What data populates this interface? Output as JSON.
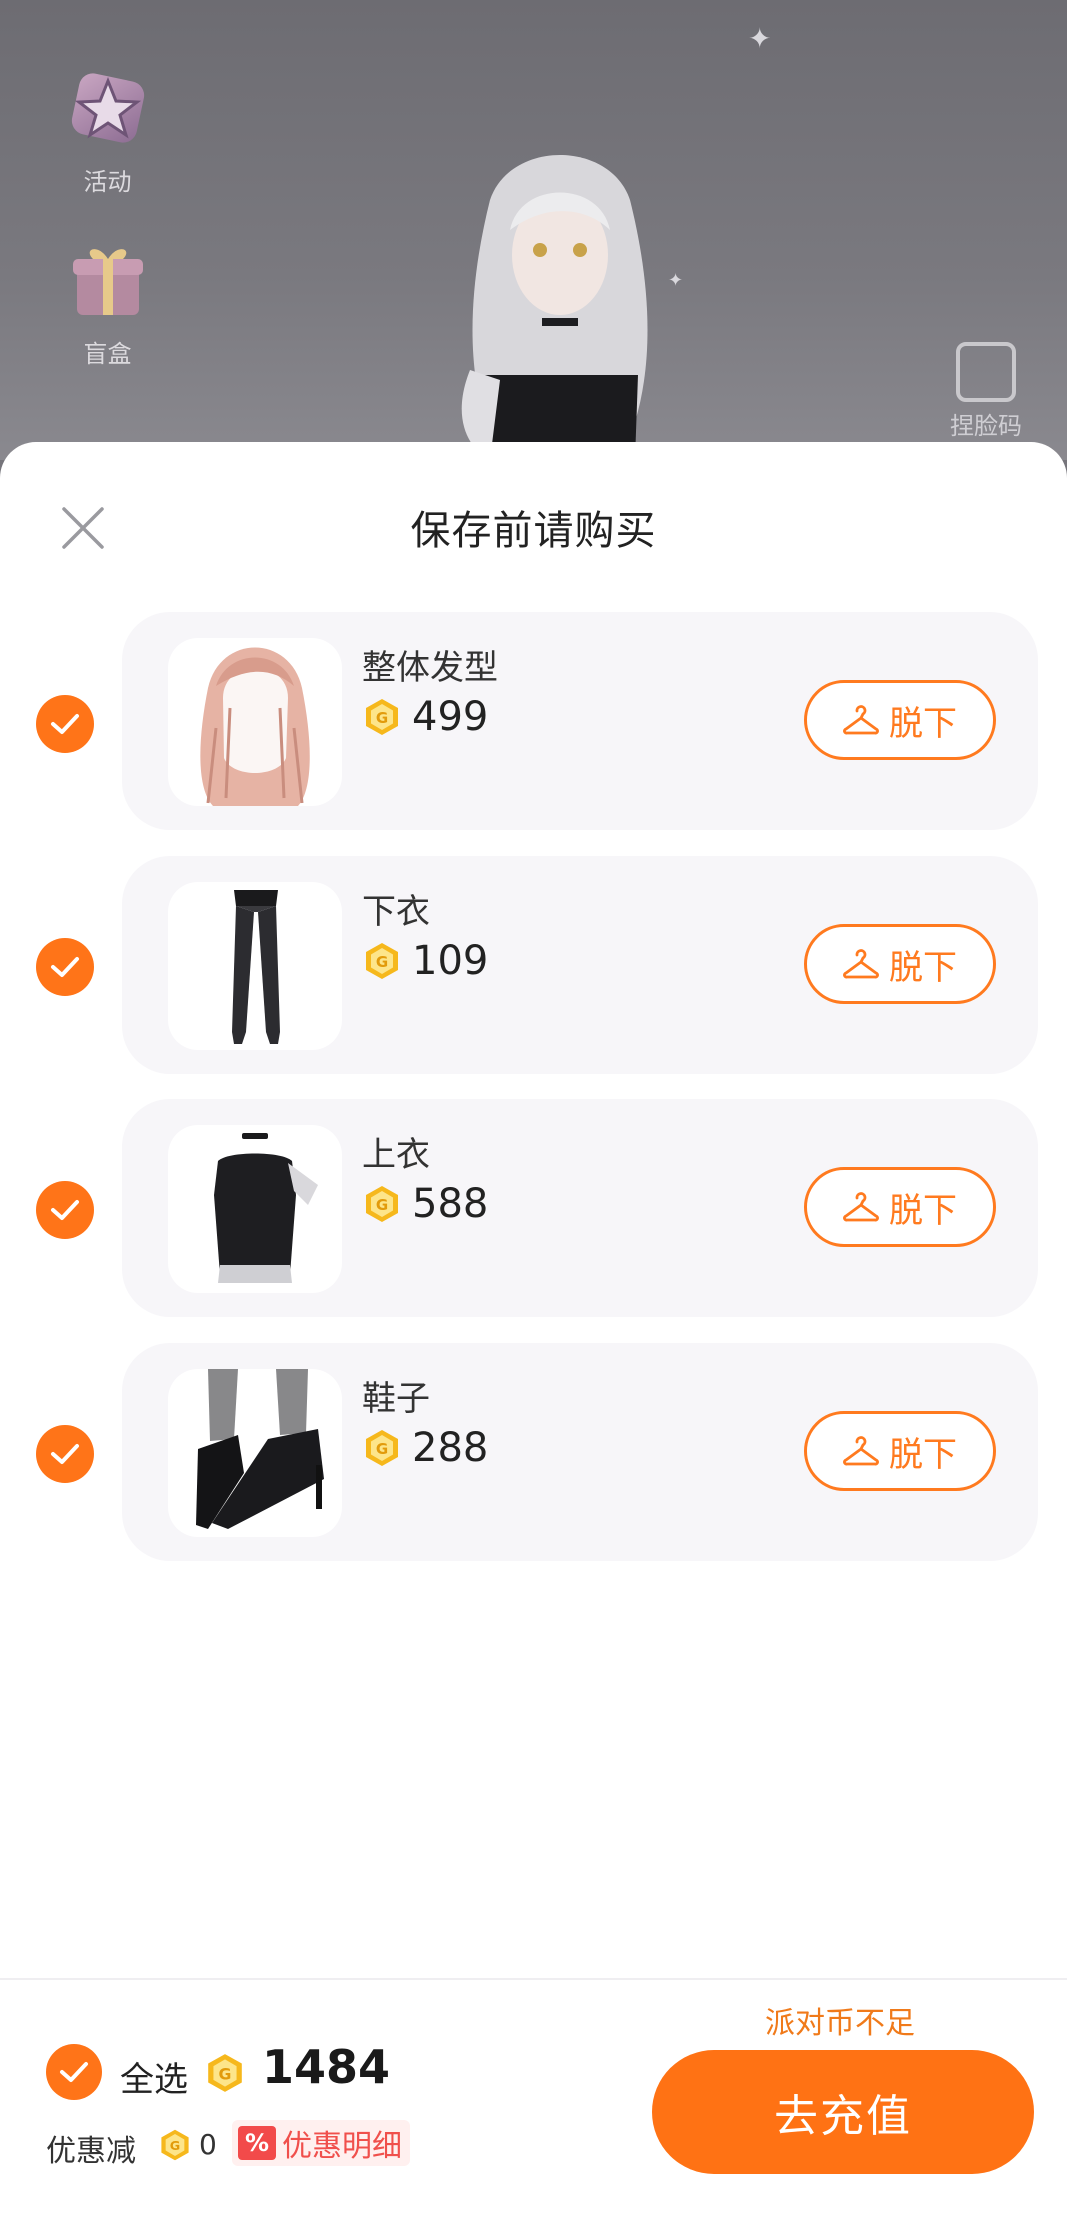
{
  "background": {
    "side_items": [
      {
        "label": "活动",
        "icon": "star-badge-icon"
      },
      {
        "label": "盲盒",
        "icon": "gift-box-icon"
      }
    ],
    "face_code_label": "捏脸码"
  },
  "sheet": {
    "title": "保存前请购买",
    "items": [
      {
        "name": "整体发型",
        "price": "499",
        "thumb": "hairstyle",
        "action": "脱下",
        "checked": true
      },
      {
        "name": "下衣",
        "price": "109",
        "thumb": "tights",
        "action": "脱下",
        "checked": true
      },
      {
        "name": "上衣",
        "price": "588",
        "thumb": "dress",
        "action": "脱下",
        "checked": true
      },
      {
        "name": "鞋子",
        "price": "288",
        "thumb": "heels",
        "action": "脱下",
        "checked": true
      }
    ]
  },
  "footer": {
    "select_all_label": "全选",
    "total": "1484",
    "discount_label": "优惠减",
    "discount_value": "0",
    "discount_badge": "%",
    "discount_detail_label": "优惠明细",
    "insufficient_text": "派对币不足",
    "recharge_label": "去充值"
  },
  "colors": {
    "accent": "#ff7418",
    "coin": "#f6b81c",
    "discount_red": "#f0504c"
  }
}
